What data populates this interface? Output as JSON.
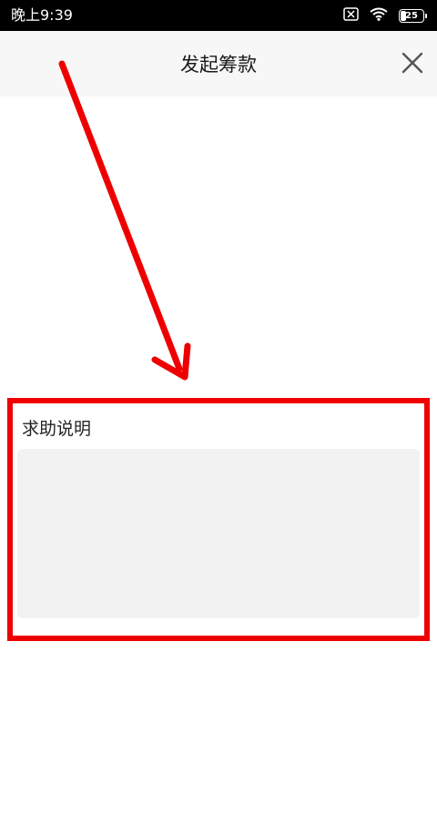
{
  "status_bar": {
    "time": "晚上9:39",
    "battery_level": "25",
    "icons": [
      "no-sim-icon",
      "wifi-icon",
      "battery-icon"
    ]
  },
  "nav": {
    "title": "发起筹款",
    "close_icon": "close-icon"
  },
  "form": {
    "help_label": "求助说明",
    "help_value": ""
  },
  "annotation": {
    "color": "#ee0000"
  }
}
